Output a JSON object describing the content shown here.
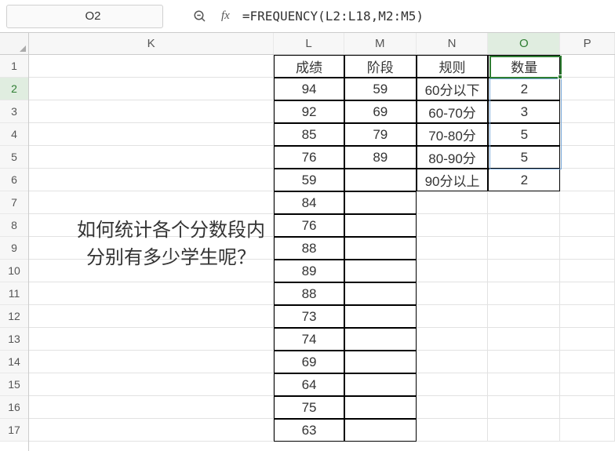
{
  "nameBox": "O2",
  "formula": "=FREQUENCY(L2:L18,M2:M5)",
  "columns": [
    "K",
    "L",
    "M",
    "N",
    "O",
    "P"
  ],
  "colWidths": [
    "col-K",
    "col-L",
    "col-M",
    "col-N",
    "col-O",
    "col-P"
  ],
  "activeCol": "O",
  "rowNumbers": [
    1,
    2,
    3,
    4,
    5,
    6,
    7,
    8,
    9,
    10,
    11,
    12,
    13,
    14,
    15,
    16,
    17
  ],
  "activeRow": 2,
  "bigText": {
    "line1": "如何统计各个分数段内",
    "line2": "分别有多少学生呢？"
  },
  "headers": {
    "L": "成绩",
    "M": "阶段",
    "N": "规则",
    "O": "数量"
  },
  "data": {
    "L": [
      94,
      92,
      85,
      76,
      59,
      84,
      76,
      88,
      89,
      88,
      73,
      74,
      69,
      64,
      75,
      63
    ],
    "M": [
      59,
      69,
      79,
      89
    ],
    "N": [
      "60分以下",
      "60-70分",
      "70-80分",
      "80-90分",
      "90分以上"
    ],
    "O": [
      2,
      3,
      5,
      5,
      2
    ]
  },
  "chart_data": {
    "type": "table",
    "title": "FREQUENCY function grouping scores into bins",
    "columns": [
      "成绩",
      "阶段",
      "规则",
      "数量"
    ],
    "scores": [
      94,
      92,
      85,
      76,
      59,
      84,
      76,
      88,
      89,
      88,
      73,
      74,
      69,
      64,
      75,
      63
    ],
    "bins": [
      59,
      69,
      79,
      89
    ],
    "bin_labels": [
      "60分以下",
      "60-70分",
      "70-80分",
      "80-90分",
      "90分以上"
    ],
    "counts": [
      2,
      3,
      5,
      5,
      2
    ]
  }
}
